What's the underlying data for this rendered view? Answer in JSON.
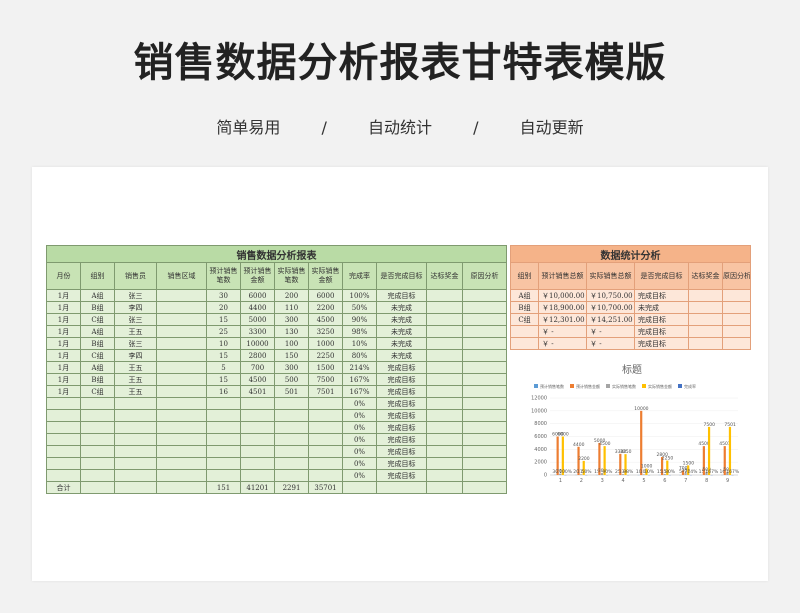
{
  "page": {
    "title": "销售数据分析报表甘特表模版",
    "subtitle_items": [
      "简单易用",
      "/",
      "自动统计",
      "/",
      "自动更新"
    ]
  },
  "main_table": {
    "caption": "销售数据分析报表",
    "headers": [
      "月份",
      "组别",
      "销售员",
      "销售区域",
      "预计销售笔数",
      "预计销售金额",
      "实际销售笔数",
      "实际销售金额",
      "完成率",
      "是否完成目标",
      "达标奖金",
      "原因分析"
    ],
    "rows": [
      [
        "1月",
        "A组",
        "张三",
        "",
        "30",
        "6000",
        "200",
        "6000",
        "100%",
        "完成目标",
        "",
        ""
      ],
      [
        "1月",
        "B组",
        "李四",
        "",
        "20",
        "4400",
        "110",
        "2200",
        "50%",
        "未完成",
        "",
        ""
      ],
      [
        "1月",
        "C组",
        "张三",
        "",
        "15",
        "5000",
        "300",
        "4500",
        "90%",
        "未完成",
        "",
        ""
      ],
      [
        "1月",
        "A组",
        "王五",
        "",
        "25",
        "3300",
        "130",
        "3250",
        "98%",
        "未完成",
        "",
        ""
      ],
      [
        "1月",
        "B组",
        "张三",
        "",
        "10",
        "10000",
        "100",
        "1000",
        "10%",
        "未完成",
        "",
        ""
      ],
      [
        "1月",
        "C组",
        "李四",
        "",
        "15",
        "2800",
        "150",
        "2250",
        "80%",
        "未完成",
        "",
        ""
      ],
      [
        "1月",
        "A组",
        "王五",
        "",
        "5",
        "700",
        "300",
        "1500",
        "214%",
        "完成目标",
        "",
        ""
      ],
      [
        "1月",
        "B组",
        "王五",
        "",
        "15",
        "4500",
        "500",
        "7500",
        "167%",
        "完成目标",
        "",
        ""
      ],
      [
        "1月",
        "C组",
        "王五",
        "",
        "16",
        "4501",
        "501",
        "7501",
        "167%",
        "完成目标",
        "",
        ""
      ],
      [
        "",
        "",
        "",
        "",
        "",
        "",
        "",
        "",
        "0%",
        "完成目标",
        "",
        ""
      ],
      [
        "",
        "",
        "",
        "",
        "",
        "",
        "",
        "",
        "0%",
        "完成目标",
        "",
        ""
      ],
      [
        "",
        "",
        "",
        "",
        "",
        "",
        "",
        "",
        "0%",
        "完成目标",
        "",
        ""
      ],
      [
        "",
        "",
        "",
        "",
        "",
        "",
        "",
        "",
        "0%",
        "完成目标",
        "",
        ""
      ],
      [
        "",
        "",
        "",
        "",
        "",
        "",
        "",
        "",
        "0%",
        "完成目标",
        "",
        ""
      ],
      [
        "",
        "",
        "",
        "",
        "",
        "",
        "",
        "",
        "0%",
        "完成目标",
        "",
        ""
      ],
      [
        "",
        "",
        "",
        "",
        "",
        "",
        "",
        "",
        "0%",
        "完成目标",
        "",
        ""
      ]
    ],
    "total": [
      "合计",
      "",
      "",
      "",
      "151",
      "41201",
      "2291",
      "35701",
      "",
      "",
      "",
      ""
    ]
  },
  "stat_table": {
    "caption": "数据统计分析",
    "headers": [
      "组别",
      "预计销售总额",
      "实际销售总额",
      "是否完成目标",
      "达标奖金",
      "原因分析"
    ],
    "rows": [
      [
        "A组",
        "￥10,000.00",
        "￥10,750.00",
        "完成目标",
        "",
        ""
      ],
      [
        "B组",
        "￥18,900.00",
        "￥10,700.00",
        "未完成",
        "",
        ""
      ],
      [
        "C组",
        "￥12,301.00",
        "￥14,251.00",
        "完成目标",
        "",
        ""
      ],
      [
        "",
        "￥      -",
        "￥      -",
        "完成目标",
        "",
        ""
      ],
      [
        "",
        "￥      -",
        "￥      -",
        "完成目标",
        "",
        ""
      ]
    ]
  },
  "chart_data": {
    "type": "bar",
    "title": "标题",
    "categories": [
      "1",
      "2",
      "3",
      "4",
      "5",
      "6",
      "7",
      "8",
      "9"
    ],
    "ylim": [
      0,
      12000
    ],
    "yticks": [
      "0",
      "2000",
      "4000",
      "6000",
      "8000",
      "10000",
      "12000"
    ],
    "legend_position": "top",
    "series": [
      {
        "name": "预计销售笔数",
        "color": "#5b9bd5",
        "values": [
          30,
          20,
          15,
          25,
          10,
          15,
          5,
          15,
          16
        ],
        "labels": [
          "30",
          "20",
          "15",
          "25",
          "10",
          "15",
          "5",
          "15",
          "16"
        ]
      },
      {
        "name": "预计销售金额",
        "color": "#ed7d31",
        "values": [
          6000,
          4400,
          5000,
          3300,
          10000,
          2800,
          700,
          4500,
          4501
        ],
        "labels": [
          "6000",
          "4400",
          "5000",
          "3300",
          "10000",
          "2800",
          "700",
          "4500",
          "4501"
        ]
      },
      {
        "name": "实际销售笔数",
        "color": "#a5a5a5",
        "values": [
          200,
          110,
          300,
          130,
          100,
          150,
          300,
          500,
          501
        ],
        "labels": [
          "200",
          "110",
          "300",
          "130",
          "100",
          "150",
          "300",
          "500",
          "501"
        ]
      },
      {
        "name": "实际销售金额",
        "color": "#ffc000",
        "values": [
          6000,
          2200,
          4500,
          3250,
          1000,
          2250,
          1500,
          7500,
          7501
        ],
        "labels": [
          "6000",
          "2200",
          "4500",
          "3250",
          "1000",
          "2250",
          "1500",
          "7500",
          "7501"
        ]
      },
      {
        "name": "完成率",
        "color": "#4472c4",
        "values": [
          1,
          0.5,
          0.9,
          0.98,
          0.1,
          0.8,
          2.14,
          1.67,
          1.67
        ],
        "labels": [
          "100%",
          "50%",
          "90%",
          "98%",
          "10%",
          "80%",
          "214%",
          "167%",
          "167%"
        ]
      }
    ]
  }
}
